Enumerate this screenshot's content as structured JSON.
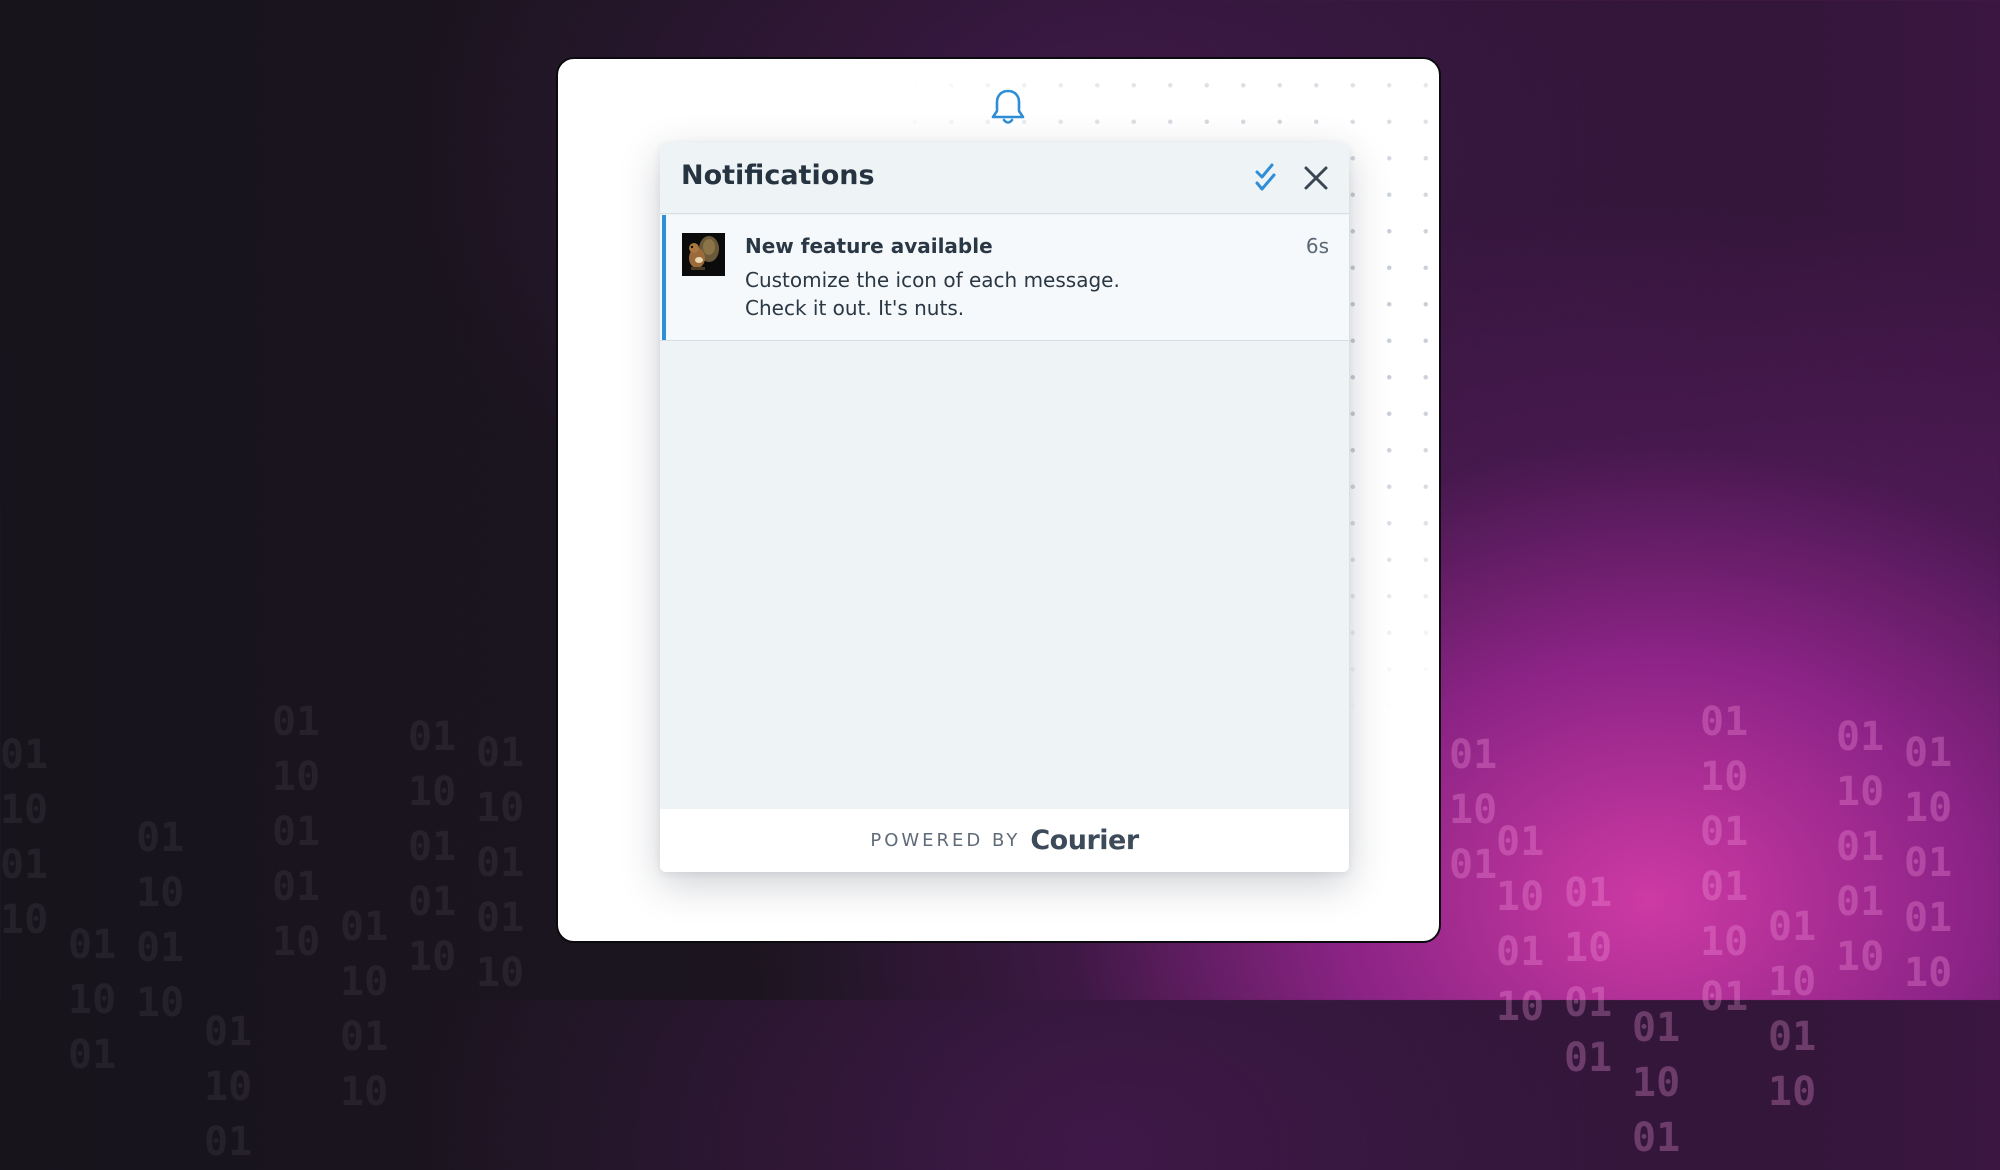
{
  "background": {
    "binary_left": [
      "01\n10\n01\n10",
      "\n\n01\n10\n01",
      "\n01\n10\n01\n10",
      "\n\n\n01\n10\n01",
      "01\n10\n01\n01\n10",
      "\n\n01\n10\n01\n10",
      "01\n10\n01\n01\n10",
      "01\n10\n01\n01\n10"
    ],
    "binary_right": [
      "01\n10\n01",
      "\n01\n10\n01\n10",
      "\n\n01\n10\n01\n01",
      "\n\n\n01\n10\n01",
      "01\n10\n01\n01\n10\n01",
      "\n\n01\n10\n01\n10",
      "01\n10\n01\n01\n10",
      "01\n10\n01\n01\n10"
    ]
  },
  "inbox": {
    "bell_icon": "bell-icon",
    "header": {
      "title": "Notifications",
      "mark_all_read_icon": "double-check-icon",
      "close_icon": "close-icon"
    },
    "messages": [
      {
        "title": "New feature available",
        "body": "Customize the icon of each message. Check it out. It's nuts.",
        "time": "6s",
        "avatar": "squirrel-image",
        "unread": true
      }
    ],
    "footer": {
      "powered_by": "POWERED BY",
      "brand": "Courier"
    }
  },
  "colors": {
    "accent": "#2f8ed8",
    "title_text": "#263340",
    "body_text": "#2a3744"
  }
}
